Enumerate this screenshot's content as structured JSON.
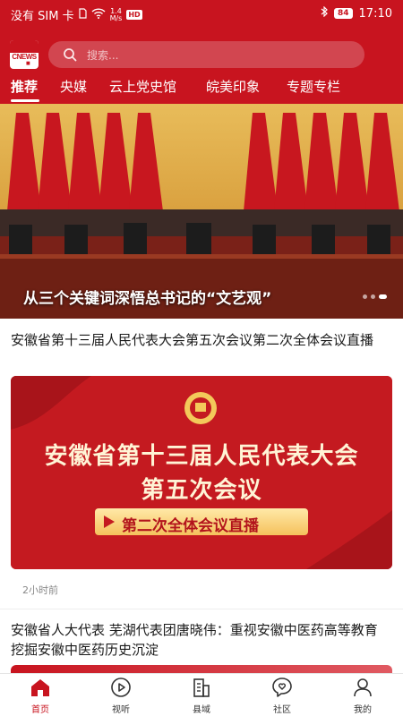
{
  "status_bar": {
    "carrier": "没有 SIM 卡",
    "speed_value": "1.4",
    "speed_unit": "M/s",
    "hd": "HD",
    "battery": "84",
    "time": "17:10"
  },
  "header": {
    "logo_text": "CNEWS",
    "search_placeholder": "搜索..."
  },
  "tabs": [
    {
      "label": "推荐",
      "active": true
    },
    {
      "label": "央媒"
    },
    {
      "label": "云上党史馆"
    },
    {
      "label": "皖美印象"
    },
    {
      "label": "专题专栏"
    }
  ],
  "banner": {
    "caption": "从三个关键词深悟总书记的“文艺观”",
    "slide_count": 3,
    "active_slide": 3
  },
  "articles": [
    {
      "title": "安徽省第十三届人民代表大会第五次会议第二次全体会议直播",
      "image_line1": "安徽省第十三届人民代表大会",
      "image_line2": "第五次会议",
      "image_button": "第二次全体会议直播",
      "time": "2小时前"
    },
    {
      "title": "安徽省人大代表 芜湖代表团唐晓伟：重视安徽中医药高等教育 挖掘安徽中医药历史沉淀"
    }
  ],
  "bottom_nav": [
    {
      "label": "首页",
      "icon": "home-icon",
      "active": true
    },
    {
      "label": "视听",
      "icon": "play-icon"
    },
    {
      "label": "县域",
      "icon": "building-icon"
    },
    {
      "label": "社区",
      "icon": "chat-heart-icon"
    },
    {
      "label": "我的",
      "icon": "user-icon"
    }
  ],
  "colors": {
    "brand_red": "#c8141f",
    "banner_gold": "#d9a94a"
  }
}
